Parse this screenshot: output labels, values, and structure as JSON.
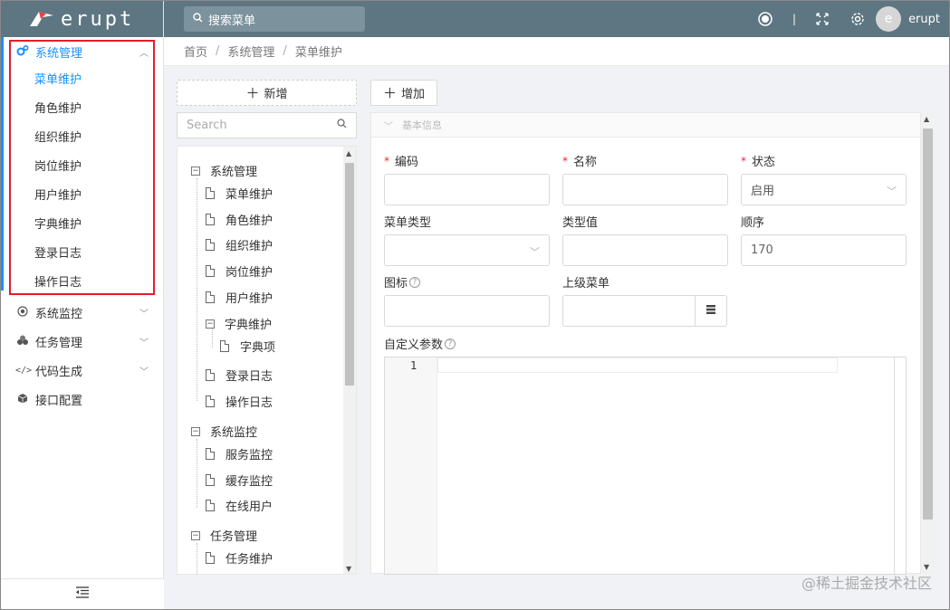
{
  "app": {
    "logo_text": "erupt"
  },
  "header": {
    "search_placeholder": "搜索菜单",
    "username": "erupt",
    "avatar_letter": "e"
  },
  "sidebar": {
    "groups": [
      {
        "label": "系统管理",
        "icon": "gears-icon",
        "expanded": true,
        "items": [
          "菜单维护",
          "角色维护",
          "组织维护",
          "岗位维护",
          "用户维护",
          "字典维护",
          "登录日志",
          "操作日志"
        ]
      },
      {
        "label": "系统监控",
        "icon": "monitor-icon"
      },
      {
        "label": "任务管理",
        "icon": "task-icon"
      },
      {
        "label": "代码生成",
        "icon": "code-icon"
      },
      {
        "label": "接口配置",
        "icon": "cube-icon"
      }
    ]
  },
  "breadcrumb": [
    "首页",
    "系统管理",
    "菜单维护"
  ],
  "tree": {
    "add_label": "新增",
    "search_placeholder": "Search",
    "nodes": {
      "sys": "系统管理",
      "menu": "菜单维护",
      "role": "角色维护",
      "org": "组织维护",
      "post": "岗位维护",
      "user": "用户维护",
      "dict": "字典维护",
      "dict_item": "字典项",
      "login_log": "登录日志",
      "op_log": "操作日志",
      "monitor": "系统监控",
      "server": "服务监控",
      "cache": "缓存监控",
      "online": "在线用户",
      "task": "任务管理",
      "task_maint": "任务维护"
    }
  },
  "form": {
    "add_label": "增加",
    "section_title": "基本信息",
    "fields": {
      "code": {
        "label": "编码",
        "value": ""
      },
      "name": {
        "label": "名称",
        "value": ""
      },
      "status": {
        "label": "状态",
        "value": "启用"
      },
      "menu_type": {
        "label": "菜单类型",
        "value": ""
      },
      "type_value": {
        "label": "类型值",
        "value": ""
      },
      "order": {
        "label": "顺序",
        "value": "170"
      },
      "icon": {
        "label": "图标",
        "value": ""
      },
      "parent": {
        "label": "上级菜单",
        "value": ""
      },
      "params": {
        "label": "自定义参数"
      }
    },
    "editor_line": "1"
  },
  "watermark": "@稀土掘金技术社区",
  "colors": {
    "header": "#5d7682",
    "accent": "#1890ff",
    "required": "#f5222d",
    "highlight_box": "#e41d2a"
  }
}
